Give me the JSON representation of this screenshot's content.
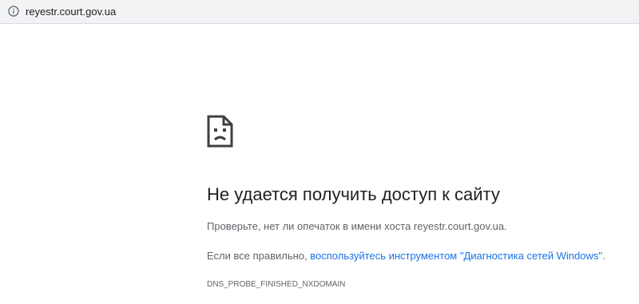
{
  "address_bar": {
    "icon": "info-icon",
    "url": "reyestr.court.gov.ua"
  },
  "error_page": {
    "icon": "sad-document-icon",
    "heading": "Не удается получить доступ к сайту",
    "suggestion_1": "Проверьте, нет ли опечаток в имени хоста reyestr.court.gov.ua.",
    "suggestion_2_prefix": "Если все правильно, ",
    "suggestion_2_link": "воспользуйтесь инструментом \"Диагностика сетей Windows\"",
    "suggestion_2_suffix": ".",
    "error_code": "DNS_PROBE_FINISHED_NXDOMAIN"
  },
  "colors": {
    "link": "#1a73e8",
    "heading": "#202124",
    "body_text": "#5f6368",
    "omnibox_background": "#f1f3f4"
  }
}
